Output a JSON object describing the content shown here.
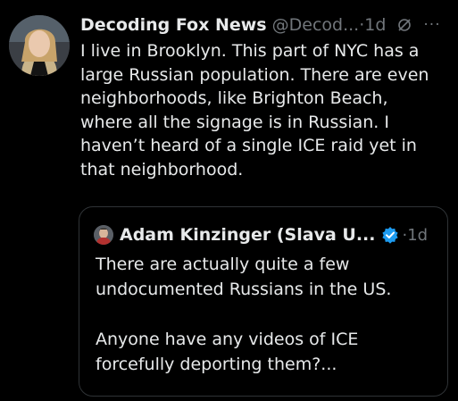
{
  "tweet": {
    "author": {
      "display_name": "Decoding Fox News",
      "handle": "@Decod...",
      "time": "·1d"
    },
    "text_lines": [
      "I live in Brooklyn. This part of NYC has a",
      "large Russian population. There are even",
      "neighborhoods, like Brighton Beach,",
      "where all the signage is in Russian. I",
      "haven’t heard of a single ICE raid yet in",
      "that neighborhood."
    ],
    "more_label": "···",
    "icons": {
      "edited": "edited-icon",
      "more": "more-icon"
    }
  },
  "quote": {
    "author": {
      "display_name": "Adam Kinzinger (Slava U...",
      "time": "·1d"
    },
    "paragraphs": [
      [
        "There are actually quite a few",
        "undocumented Russians in the US."
      ],
      [
        "Anyone have any videos of ICE",
        "forcefully deporting them?..."
      ]
    ],
    "icons": {
      "verified": "verified-badge-icon"
    }
  },
  "colors": {
    "background": "#000000",
    "text": "#e7e9ea",
    "muted": "#71767b",
    "border": "#2f3336",
    "verified": "#1d9bf0"
  }
}
